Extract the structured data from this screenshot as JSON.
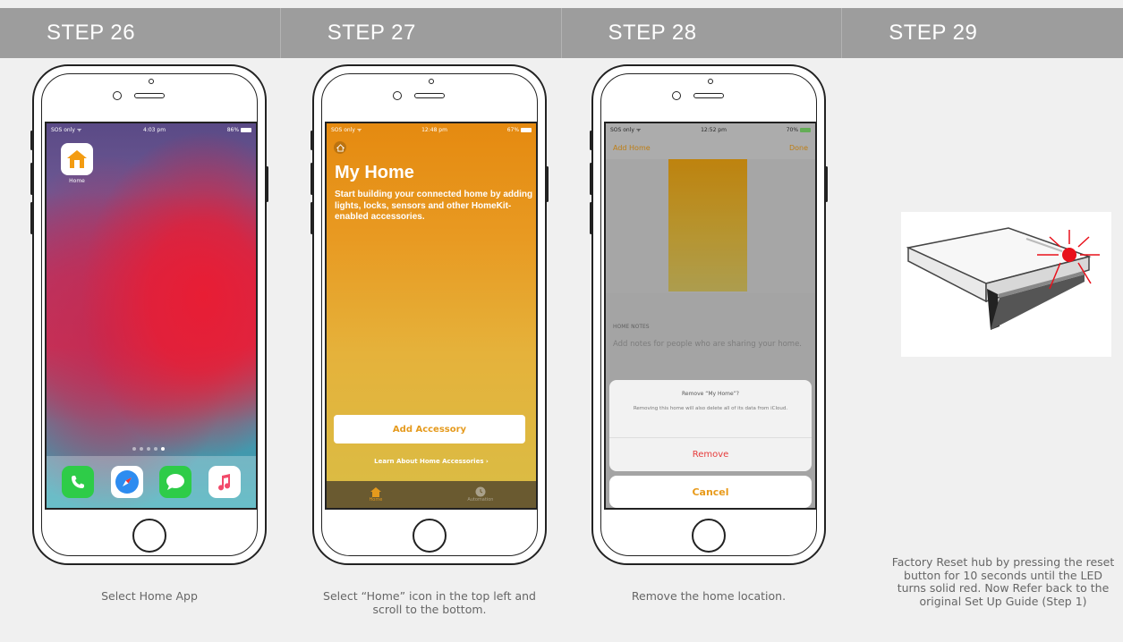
{
  "steps": [
    {
      "label": "STEP 26",
      "caption": "Select Home App"
    },
    {
      "label": "STEP 27",
      "caption": "Select “Home” icon in the top left and scroll to the bottom."
    },
    {
      "label": "STEP 28",
      "caption": "Remove the home location."
    },
    {
      "label": "STEP 29",
      "caption": "Factory Reset hub by pressing the reset button for 10 seconds until the LED turns solid red. Now Refer back to the original Set Up Guide (Step 1)"
    }
  ],
  "phone1": {
    "status_left": "SOS only ᯤ",
    "status_time": "4:03 pm",
    "status_right": "86%",
    "app_label": "Home",
    "dock_icons": [
      "phone-icon",
      "safari-icon",
      "messages-icon",
      "music-icon"
    ]
  },
  "phone2": {
    "status_left": "SOS only ᯤ",
    "status_time": "12:48 pm",
    "status_right": "67%",
    "title": "My Home",
    "description": "Start building your connected home by adding lights, locks, sensors and other HomeKit-enabled accessories.",
    "add_accessory": "Add Accessory",
    "learn_link": "Learn About Home Accessories ›",
    "tab_home": "Home",
    "tab_automation": "Automation"
  },
  "phone3": {
    "status_left": "SOS only ᯤ",
    "status_time": "12:52 pm",
    "status_right": "70%",
    "nav_left": "Add Home",
    "nav_right": "Done",
    "notes_header": "HOME NOTES",
    "notes_text": "Add notes for people who are sharing your home.",
    "sheet_title": "Remove “My Home”?",
    "sheet_message": "Removing this home will also delete all of its data from iCloud.",
    "remove": "Remove",
    "cancel": "Cancel"
  },
  "colors": {
    "header_bg": "#9d9d9d",
    "home_orange": "#e59a1d",
    "remove_red": "#e63c3c",
    "led_red": "#e8101a"
  }
}
